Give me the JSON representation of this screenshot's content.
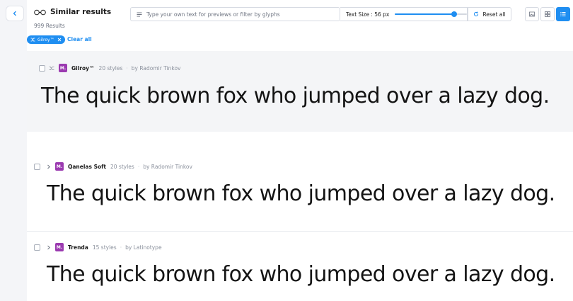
{
  "header": {
    "title": "Similar results",
    "results_count": "999 Results",
    "search_placeholder": "Type your own text for previews or filter by glyphs",
    "text_size_label": "Text Size : 56 px",
    "text_size_slider_fraction": 0.82,
    "reset_label": "Reset all"
  },
  "filters": {
    "chips": [
      {
        "label": "Gilroy™"
      }
    ],
    "clear_all_label": "Clear all"
  },
  "view_modes": [
    {
      "icon": "image-icon",
      "active": false
    },
    {
      "icon": "grid-icon",
      "active": false
    },
    {
      "icon": "list-icon",
      "active": true
    }
  ],
  "fonts": [
    {
      "logo_letter": "M.",
      "name": "Gilroy™",
      "styles": "20 styles",
      "by": "by Radomir Tinkov",
      "preview": "The quick brown fox who jumped over a lazy dog."
    },
    {
      "logo_letter": "M.",
      "name": "Qanelas Soft",
      "styles": "20 styles",
      "by": "by Radomir Tinkov",
      "preview": "The quick brown fox who jumped over a lazy dog."
    },
    {
      "logo_letter": "M.",
      "name": "Trenda",
      "styles": "15 styles",
      "by": "by Latinotype",
      "preview": "The quick brown fox who jumped over a lazy dog."
    }
  ],
  "colors": {
    "accent": "#1f8ef1",
    "foundry_logo": "#9b3ab0",
    "highlight_row": "#f4f5f7"
  }
}
